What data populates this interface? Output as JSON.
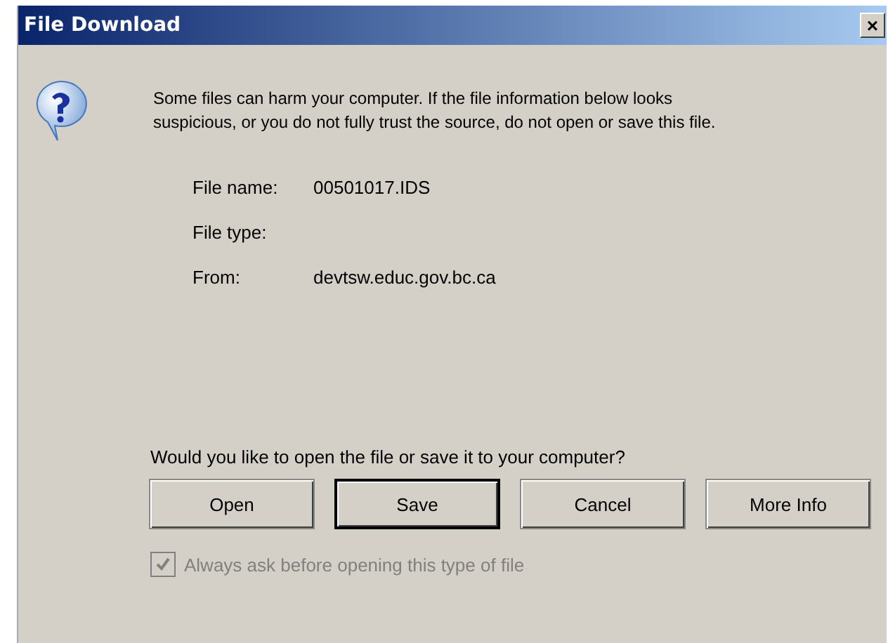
{
  "window": {
    "title": "File Download",
    "close": "×"
  },
  "message": "Some files can harm your computer. If the file information below looks suspicious, or you do not fully trust the source, do not open or save this file.",
  "fields": [
    {
      "label": "File name:",
      "value": "00501017.IDS"
    },
    {
      "label": "File type:"
    },
    {
      "label": "From:",
      "value": "devtsw.educ.gov.bc.ca"
    }
  ],
  "question": "Would you like to open the file or save it to your computer?",
  "buttons": [
    {
      "label": "Open",
      "default": false
    },
    {
      "label": "Save",
      "default": true
    },
    {
      "label": "Cancel",
      "default": false
    },
    {
      "label": "More Info",
      "default": false
    }
  ],
  "checkbox": {
    "label": "Always ask before opening this type of file",
    "checked": true,
    "disabled": true
  }
}
